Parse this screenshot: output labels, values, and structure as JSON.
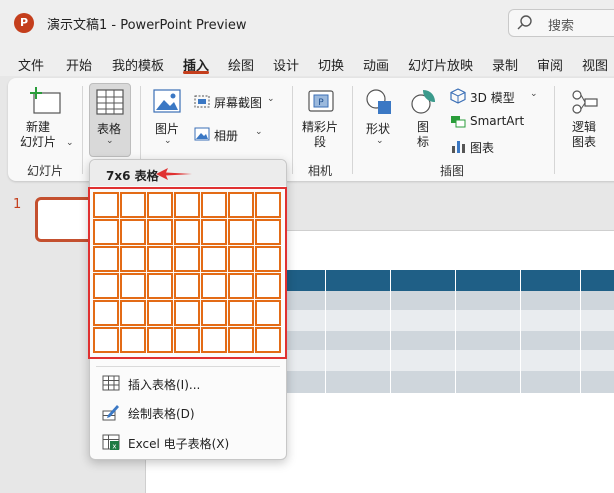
{
  "titlebar": {
    "logo": "P",
    "title": "演示文稿1  -  PowerPoint Preview",
    "search_placeholder": "搜索"
  },
  "menu": {
    "tabs": [
      "文件",
      "开始",
      "我的模板",
      "插入",
      "绘图",
      "设计",
      "切换",
      "动画",
      "幻灯片放映",
      "录制",
      "审阅",
      "视图"
    ],
    "active_tab": "插入",
    "accent_color": "#c43e1c"
  },
  "ribbon": {
    "new_slide": "新建\n幻灯片",
    "table": "表格",
    "picture": "图片",
    "screenshot": "屏幕截图",
    "album": "相册",
    "photo_album_label": "相册",
    "wonderful_clips": "精彩片\n段",
    "shapes": "形状",
    "icons": "图\n标",
    "model_3d": "3D 模型",
    "smartart": "SmartArt",
    "chart": "图表",
    "logic_chart": "逻辑\n图表",
    "groups": {
      "slides": "幻灯片",
      "camera": "相机",
      "illustrations": "插图"
    }
  },
  "slide_panel": {
    "slide_number": "1"
  },
  "table_dropdown": {
    "title": "7x6 表格",
    "grid_cols": 7,
    "grid_rows": 6,
    "selected_cols": 7,
    "selected_rows": 6,
    "items": [
      {
        "label": "插入表格(I)...",
        "icon": "table-grid-icon"
      },
      {
        "label": "绘制表格(D)",
        "icon": "pencil-table-icon"
      },
      {
        "label": "Excel 电子表格(X)",
        "icon": "excel-icon"
      }
    ]
  },
  "slide_table": {
    "header_color": "#1f5f86",
    "band_color": "#cfd6dc"
  }
}
